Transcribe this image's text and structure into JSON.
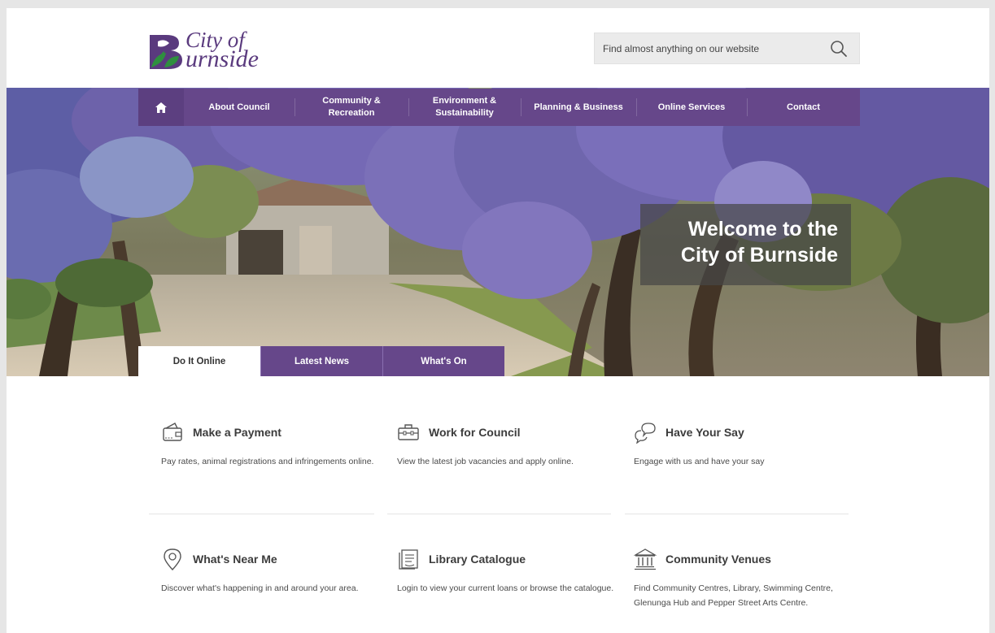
{
  "header": {
    "logo": {
      "line1": "City of",
      "line2": "urnside"
    },
    "search": {
      "placeholder": "Find almost anything on our website"
    }
  },
  "nav": {
    "home_icon": "home-icon",
    "items": [
      {
        "label": "About Council"
      },
      {
        "label": "Community & Recreation"
      },
      {
        "label": "Environment & Sustainability"
      },
      {
        "label": "Planning & Business"
      },
      {
        "label": "Online Services"
      },
      {
        "label": "Contact"
      }
    ]
  },
  "hero": {
    "welcome_line1": "Welcome to the",
    "welcome_line2": "City of Burnside"
  },
  "tabs": [
    {
      "label": "Do It Online",
      "active": true
    },
    {
      "label": "Latest News",
      "active": false
    },
    {
      "label": "What's On",
      "active": false
    }
  ],
  "cards": [
    {
      "title": "Make a Payment",
      "icon": "wallet-icon",
      "description": "Pay rates, animal registrations and infringements online."
    },
    {
      "title": "Work for Council",
      "icon": "briefcase-icon",
      "description": "View the latest job vacancies and apply online."
    },
    {
      "title": "Have Your Say",
      "icon": "chat-bubbles-icon",
      "description": "Engage with us and have your say"
    },
    {
      "title": "What's Near Me",
      "icon": "location-pin-icon",
      "description": "Discover what's happening in and around your area."
    },
    {
      "title": "Library Catalogue",
      "icon": "library-card-icon",
      "description": "Login to view your current loans or browse the catalogue."
    },
    {
      "title": "Community Venues",
      "icon": "building-icon",
      "description": "Find Community Centres, Library, Swimming Centre, Glenunga Hub and Pepper Street Arts Centre."
    }
  ],
  "colors": {
    "brand_purple": "#66478a",
    "logo_green": "#2f8f3f",
    "background": "#e6e6e6"
  }
}
